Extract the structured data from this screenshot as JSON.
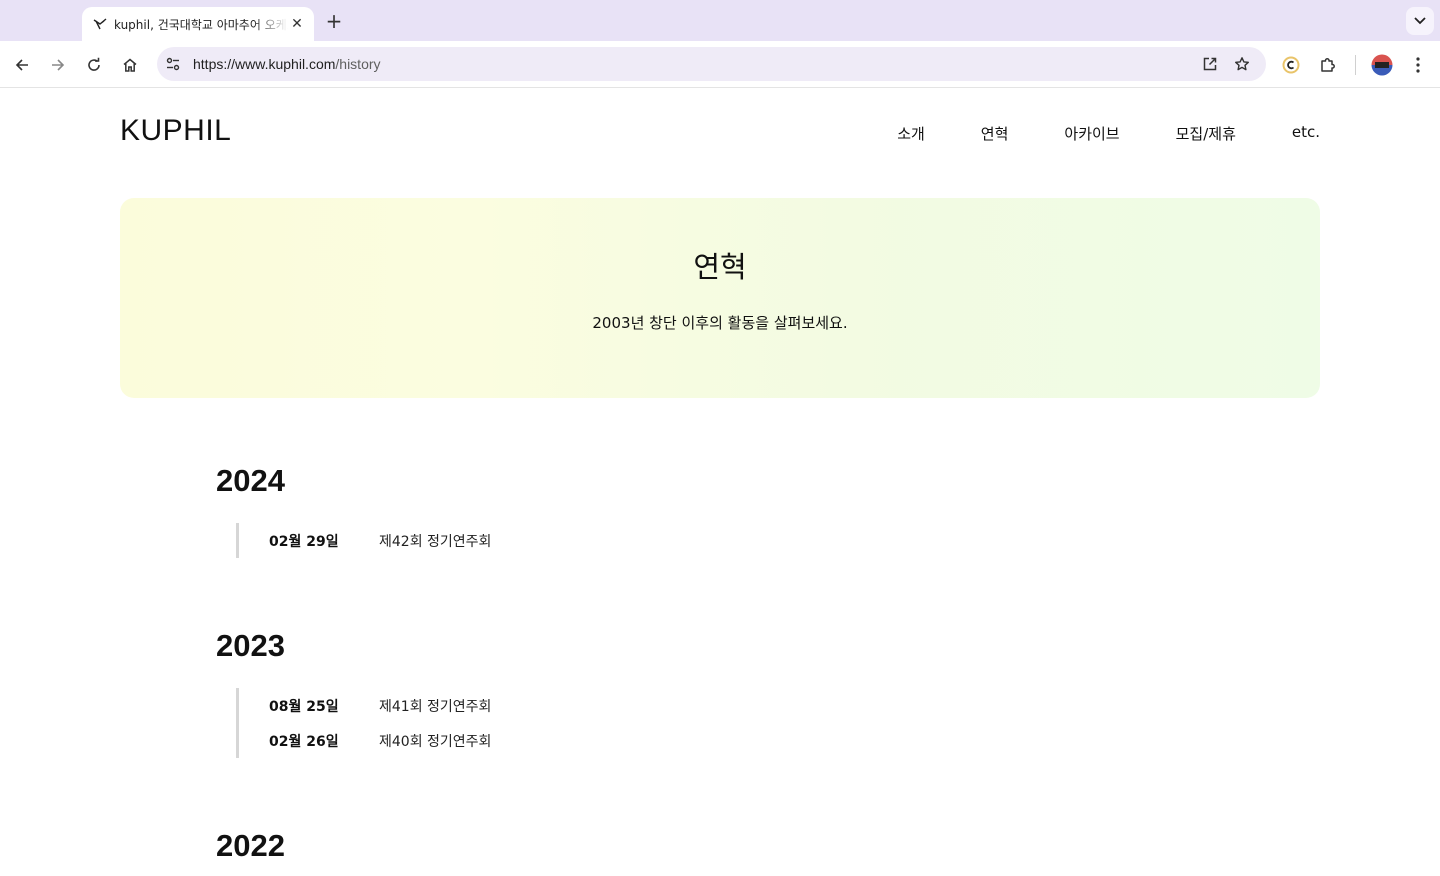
{
  "browser": {
    "tab_title": "kuphil, 건국대학교 아마추어 오케스트라",
    "url_host": "https://www.kuphil.com",
    "url_path": "/history"
  },
  "site": {
    "logo": "KUPHIL",
    "nav": [
      "소개",
      "연혁",
      "아카이브",
      "모집/제휴",
      "etc."
    ]
  },
  "hero": {
    "title": "연혁",
    "subtitle": "2003년 창단 이후의 활동을 살펴보세요."
  },
  "history": [
    {
      "year": "2024",
      "events": [
        {
          "date": "02월 29일",
          "title": "제42회 정기연주회"
        }
      ]
    },
    {
      "year": "2023",
      "events": [
        {
          "date": "08월 25일",
          "title": "제41회 정기연주회"
        },
        {
          "date": "02월 26일",
          "title": "제40회 정기연주회"
        }
      ]
    },
    {
      "year": "2022",
      "events": []
    }
  ]
}
